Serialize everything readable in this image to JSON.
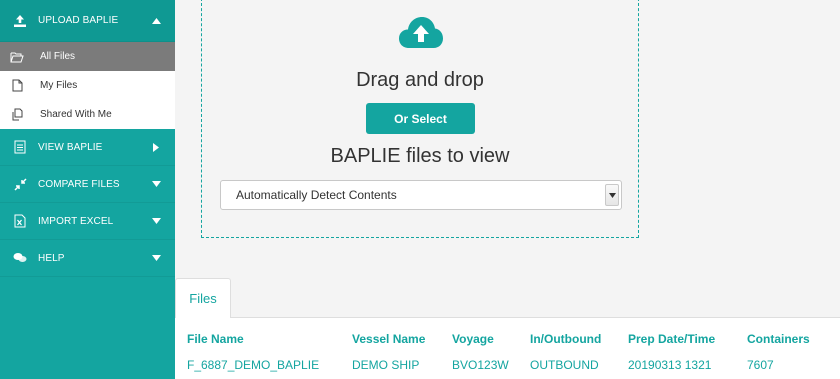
{
  "sidebar": {
    "upload": {
      "label": "UPLOAD BAPLIE"
    },
    "sub_items": [
      {
        "label": "All Files"
      },
      {
        "label": "My Files"
      },
      {
        "label": "Shared With Me"
      }
    ],
    "sections": [
      {
        "label": "VIEW BAPLIE"
      },
      {
        "label": "COMPARE FILES"
      },
      {
        "label": "IMPORT EXCEL"
      },
      {
        "label": "HELP"
      }
    ]
  },
  "dropzone": {
    "title": "Drag and drop",
    "button_label": "Or Select",
    "subtitle": "BAPLIE files to view",
    "select_value": "Automatically Detect Contents"
  },
  "files": {
    "tab_label": "Files",
    "headers": [
      "File Name",
      "Vessel Name",
      "Voyage",
      "In/Outbound",
      "Prep Date/Time",
      "Containers"
    ],
    "rows": [
      [
        "F_6887_DEMO_BAPLIE",
        "DEMO SHIP",
        "BVO123W",
        "OUTBOUND",
        "20190313 1321",
        "7607"
      ]
    ]
  },
  "colors": {
    "accent": "#14a5a0",
    "sidebar_active": "#7b7b7b"
  }
}
